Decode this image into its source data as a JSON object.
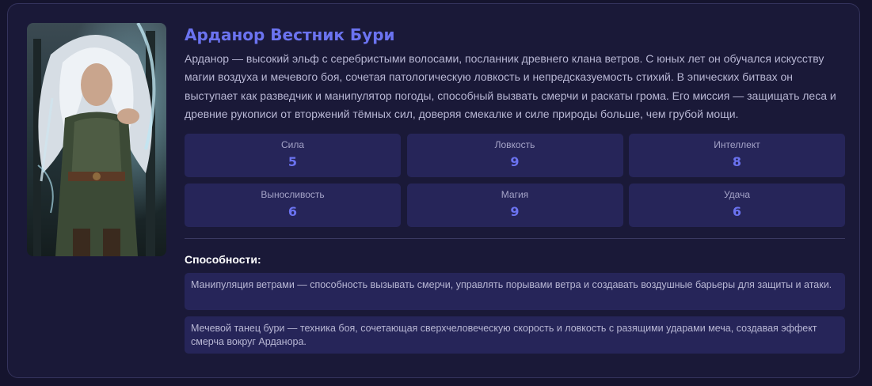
{
  "character": {
    "name": "Арданор Вестник Бури",
    "description": "Арданор — высокий эльф с серебристыми волосами, посланник древнего клана ветров. С юных лет он обучался искусству магии воздуха и мечевого боя, сочетая патологическую ловкость и непредсказуемость стихий. В эпических битвах он выступает как разведчик и манипулятор погоды, способный вызвать смерчи и раскаты грома. Его миссия — защищать леса и древние рукописи от вторжений тёмных сил, доверяя смекалке и силе природы больше, чем грубой мощи."
  },
  "stats": [
    {
      "label": "Сила",
      "value": "5"
    },
    {
      "label": "Ловкость",
      "value": "9"
    },
    {
      "label": "Интеллект",
      "value": "8"
    },
    {
      "label": "Выносливость",
      "value": "6"
    },
    {
      "label": "Магия",
      "value": "9"
    },
    {
      "label": "Удача",
      "value": "6"
    }
  ],
  "abilities": {
    "title": "Способности:",
    "items": [
      "Манипуляция ветрами — способность вызывать смерчи, управлять порывами ветра и создавать воздушные барьеры для защиты и атаки.",
      "Мечевой танец бури — техника боя, сочетающая сверхчеловеческую скорость и ловкость с разящими ударами меча, создавая эффект смерча вокруг Арданора."
    ]
  },
  "colors": {
    "page_background": "#15142e",
    "card_background": "#1a1938",
    "tile_background": "#262559",
    "accent": "#6b73f0",
    "text": "#b8b7d4"
  }
}
